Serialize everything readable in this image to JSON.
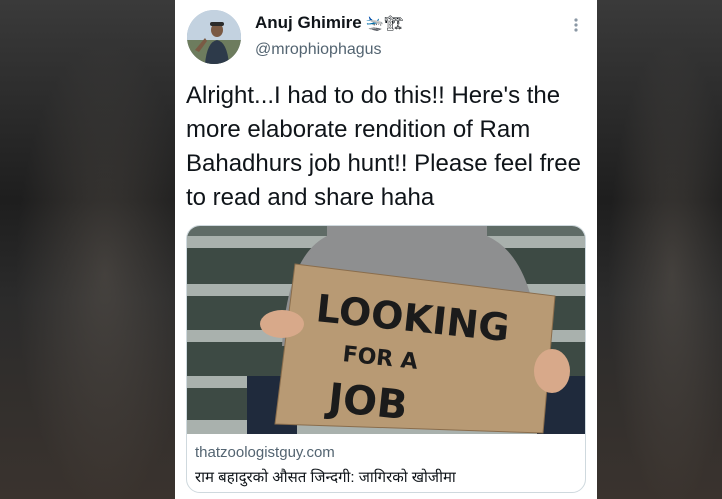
{
  "tweet": {
    "author_name": "Anuj Ghimire",
    "author_emoji": "🛬🏗",
    "handle": "@mrophiophagus",
    "text": "Alright...I had to do this!! Here's the more elaborate rendition of Ram Bahadhurs job hunt!! Please feel free to read and share haha",
    "more_icon": "more-vertical-icon"
  },
  "link_card": {
    "sign_line1": "LOOKING",
    "sign_line2": "FOR A",
    "sign_line3": "JOB",
    "domain": "thatzoologistguy.com",
    "title": "राम बहादुरको औसत जिन्दगी: जागिरको खोजीमा"
  }
}
